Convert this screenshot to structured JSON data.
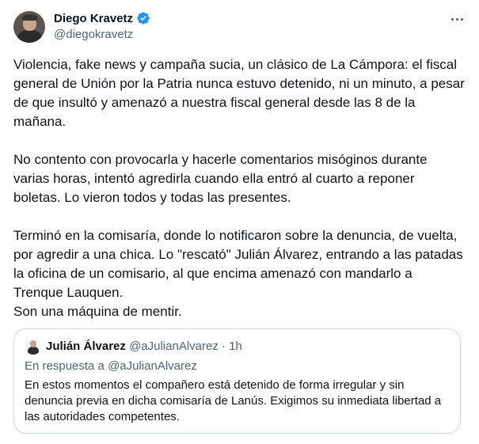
{
  "author": {
    "name": "Diego Kravetz",
    "handle": "@diegokravetz"
  },
  "tweet": {
    "paragraph1": "Violencia, fake news y campaña sucia, un clásico de La Cámpora: el fiscal general de Unión por la Patria nunca estuvo detenido, ni un minuto, a pesar de que insultó y amenazó a nuestra fiscal general desde las 8 de la mañana.",
    "paragraph2": "No contento con provocarla y hacerle comentarios misóginos durante varias horas, intentó agredirla cuando ella entró al cuarto a reponer boletas. Lo vieron todos y todas las presentes.",
    "paragraph3": "Terminó en la comisaría, donde lo notificaron sobre la denuncia, de vuelta, por agredir a una chica. Lo \"rescató\" Julián Álvarez, entrando a las patadas la oficina de un comisario, al que encima amenazó con mandarlo a Trenque Lauquen.",
    "paragraph3_last": "Son una máquina de mentir."
  },
  "quoted": {
    "name": "Julián Álvarez",
    "handle": "@aJulianAlvarez",
    "separator": "·",
    "time": "1h",
    "reply_to": "En respuesta a @aJulianAlvarez",
    "text": "En estos momentos el compañero está detenido de forma irregular  y sin denuncia previa en dicha comisaría de Lanús. Exigimos su inmediata libertad a las autoridades competentes."
  },
  "colors": {
    "verified": "#1d9bf0",
    "text": "#0f1419",
    "secondary": "#536471",
    "border": "#cfd9de"
  }
}
